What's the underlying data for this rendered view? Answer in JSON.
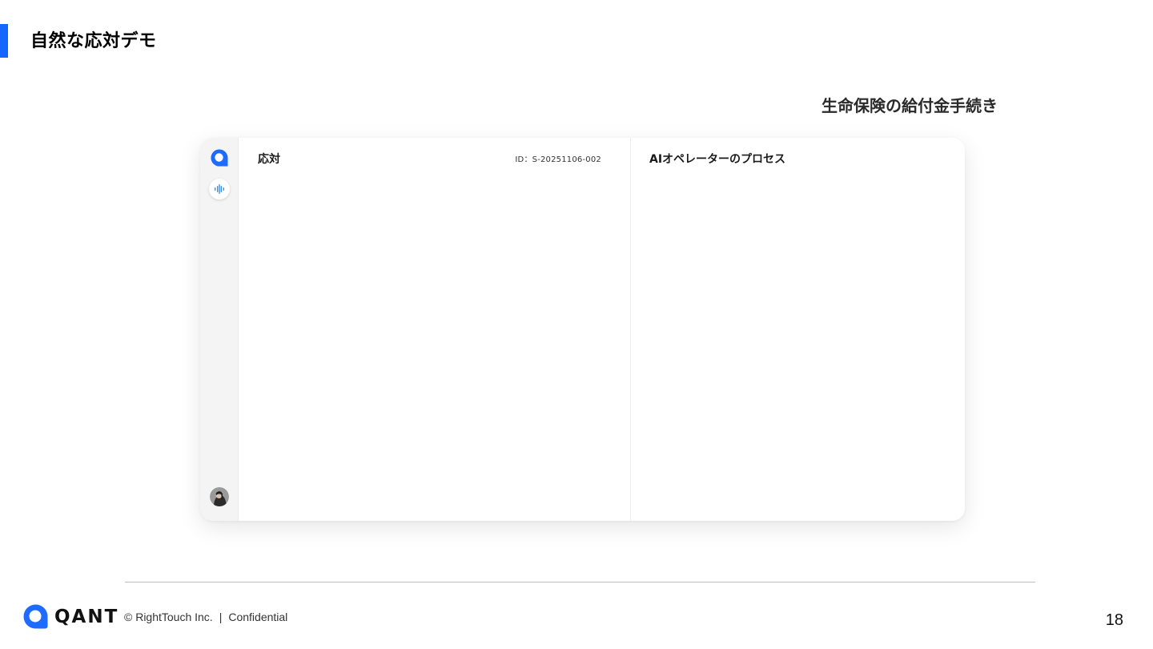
{
  "slide": {
    "title": "自然な応対デモ",
    "subtitle": "生命保険の給付金手続き",
    "page_number": "18"
  },
  "app": {
    "left_panel": {
      "title": "応対",
      "session_id": "ID：S-20251106-002"
    },
    "right_panel": {
      "title": "AIオペレーターのプロセス"
    },
    "rail": {
      "logo_icon": "qant-logo-icon",
      "voice_icon": "voice-waveform-icon",
      "avatar_icon": "user-avatar"
    }
  },
  "footer": {
    "brand_name": "QANT",
    "copyright": "© RightTouch Inc.",
    "separator": "|",
    "confidential": "Confidential"
  },
  "colors": {
    "accent": "#1565ff",
    "logo_blue": "#1f6bff"
  }
}
